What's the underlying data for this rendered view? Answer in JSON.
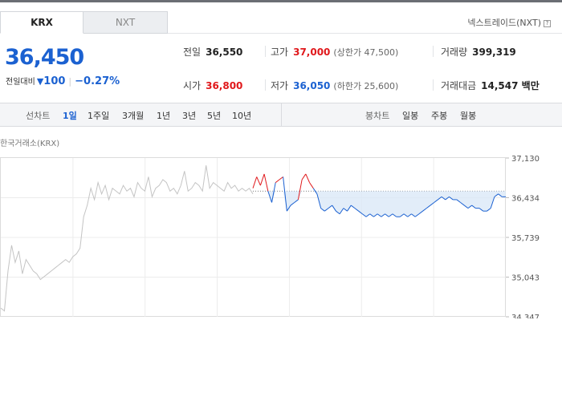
{
  "tabs": [
    {
      "label": "KRX",
      "active": true
    },
    {
      "label": "NXT",
      "active": false
    }
  ],
  "nxt_link": "넥스트레이드(NXT)",
  "help_glyph": "?",
  "quote": {
    "price": "36,450",
    "change_label": "전일대비",
    "direction_glyph": "▼",
    "change_amount": "100",
    "change_pct": "−0.27%"
  },
  "stats": {
    "prev_close": {
      "label": "전일",
      "value": "36,550"
    },
    "high": {
      "label": "고가",
      "value": "37,000",
      "sub": "(상한가 47,500)"
    },
    "volume": {
      "label": "거래량",
      "value": "399,319"
    },
    "open": {
      "label": "시가",
      "value": "36,800"
    },
    "low": {
      "label": "저가",
      "value": "36,050",
      "sub": "(하한가 25,600)"
    },
    "trade_value": {
      "label": "거래대금",
      "value": "14,547 백만"
    }
  },
  "toolbar": {
    "line_label": "선차트",
    "periods": [
      "1일",
      "1주일",
      "3개월",
      "1년",
      "3년",
      "5년",
      "10년"
    ],
    "active_period": "1일",
    "candle_label": "봉차트",
    "candles": [
      "일봉",
      "주봉",
      "월봉"
    ]
  },
  "chart_source": "한국거래소(KRX)",
  "colors": {
    "up": "#e0181b",
    "down": "#1b61d1",
    "past": "#c4c4c4",
    "fill": "#dbe8f8"
  },
  "chart_data": {
    "type": "line",
    "title": "",
    "xlabel": "",
    "ylabel": "",
    "y_ticks": [
      "37,130",
      "36,434",
      "35,739",
      "35,043",
      "34,347"
    ],
    "ylim": [
      34347,
      37130
    ],
    "reference_price": 36550,
    "grid": true,
    "series": [
      {
        "segment": "past-week",
        "color": "gray",
        "values": [
          34500,
          34450,
          35150,
          35600,
          35300,
          35500,
          35100,
          35350,
          35250,
          35150,
          35100,
          35000,
          35050,
          35100,
          35150,
          35200,
          35250,
          35300,
          35350,
          35300,
          35400,
          35450,
          35550,
          36100,
          36300,
          36600,
          36400,
          36700,
          36500,
          36650,
          36400,
          36600,
          36550,
          36500,
          36650,
          36550,
          36600,
          36450,
          36700,
          36600,
          36550,
          36800,
          36450,
          36600,
          36650,
          36750,
          36700,
          36550,
          36600,
          36500,
          36650,
          36900,
          36550,
          36600,
          36700,
          36650,
          36550,
          37000,
          36600,
          36700,
          36650,
          36600,
          36550,
          36700,
          36600,
          36650,
          36550,
          36600,
          36550,
          36600,
          36500
        ]
      },
      {
        "segment": "today",
        "color": "up/down vs reference",
        "values": [
          36600,
          36800,
          36650,
          36850,
          36550,
          36350,
          36700,
          36750,
          36800,
          36200,
          36300,
          36350,
          36400,
          36750,
          36850,
          36700,
          36600,
          36500,
          36250,
          36200,
          36250,
          36300,
          36200,
          36150,
          36250,
          36200,
          36300,
          36250,
          36200,
          36150,
          36100,
          36150,
          36100,
          36150,
          36100,
          36150,
          36100,
          36150,
          36100,
          36100,
          36150,
          36100,
          36150,
          36100,
          36150,
          36200,
          36250,
          36300,
          36350,
          36400,
          36450,
          36400,
          36450,
          36400,
          36400,
          36350,
          36300,
          36250,
          36300,
          36250,
          36250,
          36200,
          36200,
          36250,
          36450,
          36500,
          36450,
          36450
        ]
      }
    ]
  }
}
